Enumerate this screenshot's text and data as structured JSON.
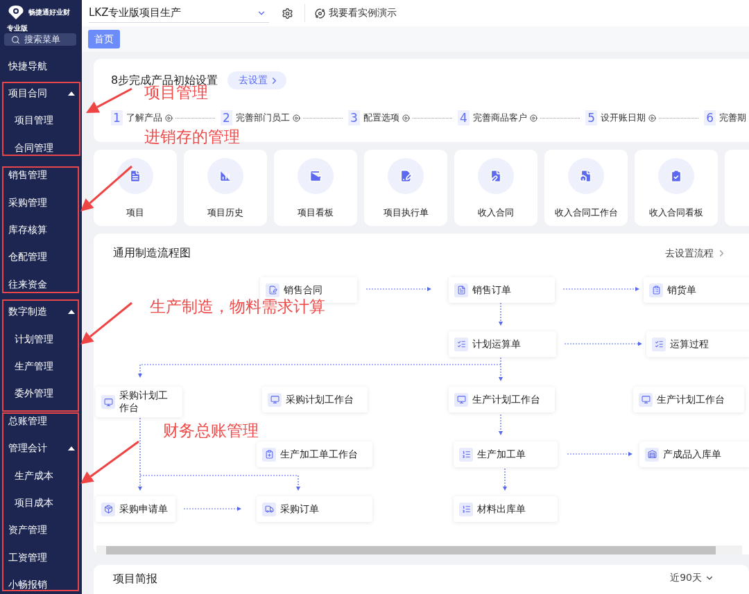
{
  "sidebar": {
    "brand": "畅捷通好业财",
    "edition": "专业版",
    "search": {
      "placeholder": "搜索菜单"
    },
    "items": [
      {
        "label": "快捷导航"
      },
      {
        "label": "项目合同",
        "expanded": true,
        "children": [
          {
            "label": "项目管理"
          },
          {
            "label": "合同管理"
          }
        ]
      },
      {
        "label": "销售管理"
      },
      {
        "label": "采购管理"
      },
      {
        "label": "库存核算"
      },
      {
        "label": "仓配管理"
      },
      {
        "label": "往来资金"
      },
      {
        "label": "数字制造",
        "expanded": true,
        "children": [
          {
            "label": "计划管理"
          },
          {
            "label": "生产管理"
          },
          {
            "label": "委外管理"
          }
        ]
      },
      {
        "label": "总账管理"
      },
      {
        "label": "管理会计",
        "expanded": true,
        "children": [
          {
            "label": "生产成本"
          },
          {
            "label": "项目成本"
          }
        ]
      },
      {
        "label": "资产管理"
      },
      {
        "label": "工资管理"
      },
      {
        "label": "小畅报销"
      }
    ]
  },
  "header": {
    "account_select": "LKZ专业版项目生产",
    "demo_link": "我要看实例演示"
  },
  "tabs": [
    {
      "label": "首页",
      "selected": true
    }
  ],
  "setup": {
    "title": "8步完成产品初始设置",
    "button": "去设置",
    "steps": [
      {
        "number": "1",
        "label": "了解产品"
      },
      {
        "number": "2",
        "label": "完善部门员工"
      },
      {
        "number": "3",
        "label": "配置选项"
      },
      {
        "number": "4",
        "label": "完善商品客户"
      },
      {
        "number": "5",
        "label": "设开账日期"
      },
      {
        "number": "6",
        "label": "完善期"
      }
    ]
  },
  "shortcuts": [
    {
      "label": "项目"
    },
    {
      "label": "项目历史"
    },
    {
      "label": "项目看板"
    },
    {
      "label": "项目执行单"
    },
    {
      "label": "收入合同"
    },
    {
      "label": "收入合同工作台"
    },
    {
      "label": "收入合同看板"
    }
  ],
  "flow": {
    "title": "通用制造流程图",
    "link": "去设置流程",
    "nodes": [
      {
        "label": "销售合同"
      },
      {
        "label": "销售订单"
      },
      {
        "label": "销货单"
      },
      {
        "label": "计划运算单"
      },
      {
        "label": "运算过程"
      },
      {
        "label": "采购计划工作台"
      },
      {
        "label": "采购计划工作台"
      },
      {
        "label": "生产计划工作台"
      },
      {
        "label": "生产计划工作台"
      },
      {
        "label": "生产加工单工作台"
      },
      {
        "label": "生产加工单"
      },
      {
        "label": "产成品入库单"
      },
      {
        "label": "采购申请单"
      },
      {
        "label": "采购订单"
      },
      {
        "label": "材料出库单"
      }
    ]
  },
  "brief": {
    "title": "项目简报",
    "period": "近90天"
  },
  "annotations": [
    {
      "label": "项目管理"
    },
    {
      "label": "进销存的管理"
    },
    {
      "label": "生产制造，物料需求计算"
    },
    {
      "label": "财务总账管理"
    }
  ]
}
